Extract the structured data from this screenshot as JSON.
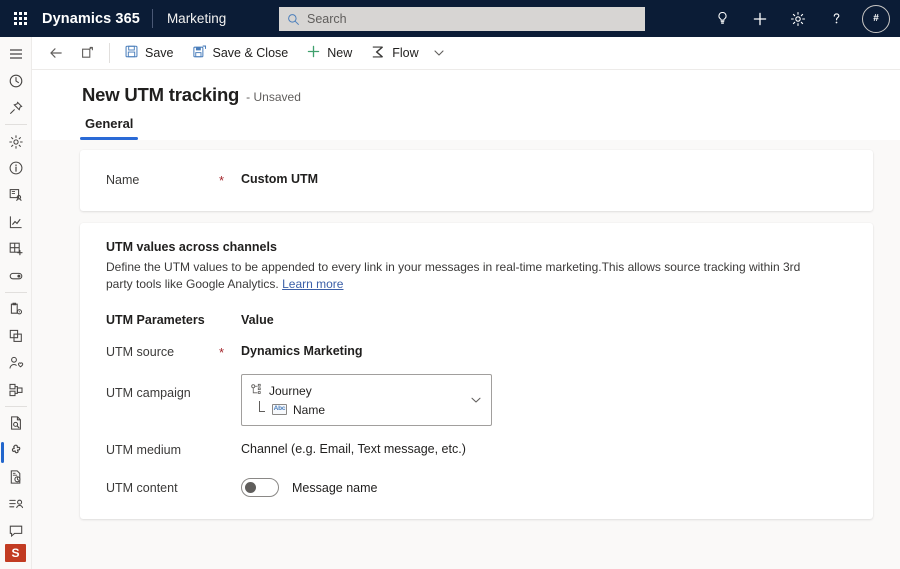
{
  "suite": {
    "waffle_icon": "app-launcher-icon",
    "brand": "Dynamics 365",
    "app_name": "Marketing",
    "search": {
      "placeholder": "Search",
      "icon": "search-icon",
      "value": ""
    },
    "actions": [
      {
        "name": "lightbulb-icon",
        "label": "Insights"
      },
      {
        "name": "plus-icon",
        "label": "Quick create"
      },
      {
        "name": "gear-icon",
        "label": "Settings"
      },
      {
        "name": "question-icon",
        "label": "Help"
      }
    ],
    "avatar": {
      "initials": "#",
      "name": "user-avatar"
    }
  },
  "rail": {
    "items": [
      {
        "name": "hamburger-menu-icon",
        "label": "Site map"
      },
      {
        "name": "recent-clock-icon",
        "label": "Recent"
      },
      {
        "name": "pin-icon",
        "label": "Pinned"
      },
      {
        "name": "gear-icon",
        "label": "Settings"
      },
      {
        "name": "info-circle-icon",
        "label": "Information"
      },
      {
        "name": "contact-card-icon",
        "label": "Contacts"
      },
      {
        "name": "chart-line-icon",
        "label": "Analytics"
      },
      {
        "name": "grid-plus-icon",
        "label": "Segments"
      },
      {
        "name": "toggle-pill-icon",
        "label": "Toggle"
      },
      {
        "name": "clipboard-gear-icon",
        "label": "Settings list"
      },
      {
        "name": "copy-pages-icon",
        "label": "Templates"
      },
      {
        "name": "person-heart-icon",
        "label": "Leads"
      },
      {
        "name": "nodes-icon",
        "label": "Assets"
      },
      {
        "name": "document-search-icon",
        "label": "Forms"
      },
      {
        "name": "puzzle-icon",
        "label": "UTM tracking"
      },
      {
        "name": "document-clock-icon",
        "label": "Schedules"
      },
      {
        "name": "list-person-icon",
        "label": "Audience"
      },
      {
        "name": "chat-bubble-icon",
        "label": "Feedback"
      }
    ],
    "selected_index": 14,
    "app_tile": {
      "label": "S",
      "name": "app-tile",
      "color": "#c23b22"
    }
  },
  "commandbar": {
    "back": {
      "label": "Back",
      "icon": "arrow-left-icon"
    },
    "popout": {
      "label": "Open in new window",
      "icon": "popout-window-icon"
    },
    "save": {
      "label": "Save",
      "icon": "save-floppy-icon"
    },
    "save_close": {
      "label": "Save & Close",
      "icon": "save-close-icon"
    },
    "new": {
      "label": "New",
      "icon": "plus-icon"
    },
    "flow": {
      "label": "Flow",
      "icon": "flow-icon"
    },
    "flow_chevron": "chevron-down-icon"
  },
  "form": {
    "title": "New UTM tracking",
    "subtitle": "- Unsaved",
    "tabs": [
      {
        "label": "General",
        "active": true
      }
    ]
  },
  "name_card": {
    "label": "Name",
    "required": "*",
    "value": "Custom UTM"
  },
  "utm_card": {
    "section_title": "UTM values across channels",
    "description": "Define the UTM values to be appended to every link in your messages in real-time marketing.This allows source tracking within 3rd party tools like Google Analytics.",
    "learn_more": "Learn more",
    "columns": {
      "parameters": "UTM Parameters",
      "value": "Value"
    },
    "rows": {
      "source": {
        "label": "UTM source",
        "required": "*",
        "value": "Dynamics Marketing"
      },
      "campaign": {
        "label": "UTM campaign",
        "token_parent": "Journey",
        "token_parent_icon": "journey-icon",
        "token_child": "Name",
        "token_child_icon": "abc-text-icon",
        "chevron": "chevron-down-icon"
      },
      "medium": {
        "label": "UTM medium",
        "value": "Channel (e.g. Email, Text message, etc.)"
      },
      "content": {
        "label": "UTM content",
        "toggle_state": "off",
        "toggle_label": "Message name"
      }
    }
  },
  "colors": {
    "suite_bar": "#0b1c36",
    "accent": "#2a6ad6",
    "required": "#a4262c",
    "canvas": "#faf9f8",
    "app_tile": "#c23b22"
  }
}
